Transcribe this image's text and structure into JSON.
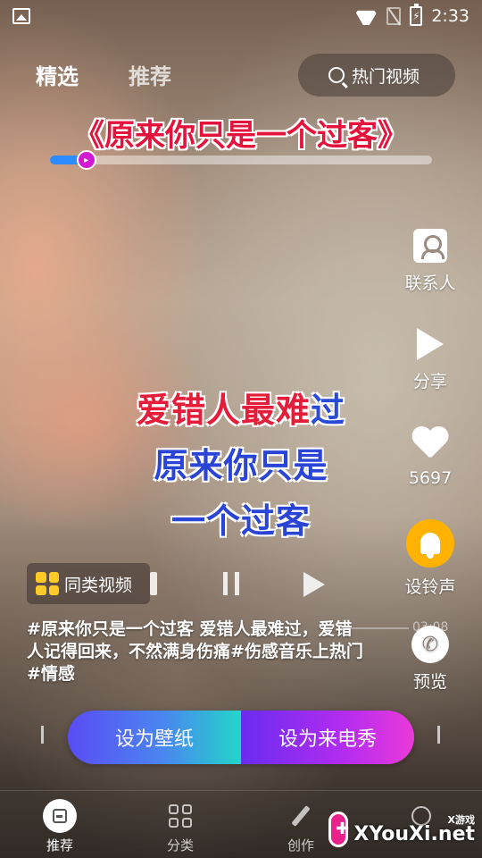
{
  "status_bar": {
    "time": "2:33"
  },
  "tabs": [
    {
      "label": "精选"
    },
    {
      "label": "推荐"
    }
  ],
  "search": {
    "label": "热门视频"
  },
  "song": {
    "title": "《原来你只是一个过客》",
    "progress": 0.06
  },
  "lyrics": {
    "line1_a": "爱错人最难",
    "line1_b": "过",
    "line2": "原来你只是",
    "line3": "一个过客"
  },
  "sidebar": {
    "contacts_label": "联系人",
    "share_label": "分享",
    "like_count": "5697",
    "ringtone_label": "设铃声",
    "preview_label": "预览"
  },
  "controls": {
    "similar_label": "同类视频",
    "time": "03:08"
  },
  "description": "#原来你只是一个过客 爱错人最难过，爱错人记得回来，不然满身伤痛#伤感音乐上热门#情感",
  "actions": {
    "wallpaper_label": "设为壁纸",
    "callshow_label": "设为来电秀"
  },
  "bottom_nav": [
    {
      "label": "推荐"
    },
    {
      "label": "分类"
    },
    {
      "label": "创作"
    }
  ],
  "watermark": {
    "small": "X游戏",
    "big": "XYouXi.net"
  }
}
